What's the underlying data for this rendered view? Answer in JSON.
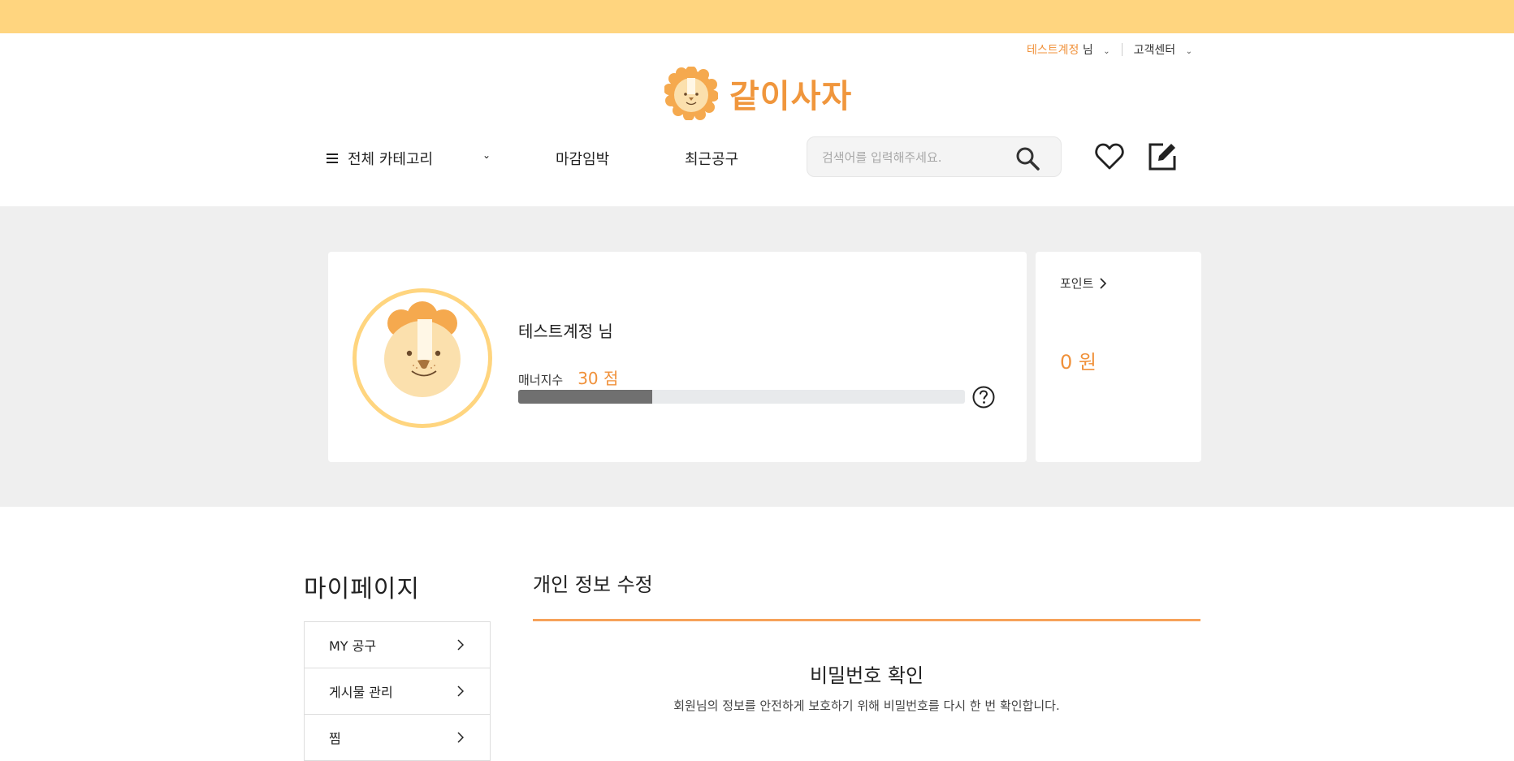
{
  "header": {
    "user_name": "테스트계정",
    "user_suffix": "님",
    "customer_center": "고객센터",
    "logo_text": "같이사자"
  },
  "nav": {
    "all_categories": "전체 카테고리",
    "deadline": "마감임박",
    "recent_group_buy": "최근공구",
    "search_placeholder": "검색어를 입력해주세요."
  },
  "profile": {
    "name": "테스트계정 님",
    "manner_label": "매너지수",
    "manner_value": "30 점",
    "manner_progress": 0.3
  },
  "point": {
    "label": "포인트",
    "value": "0 원"
  },
  "mypage": {
    "title": "마이페이지",
    "menu": [
      {
        "label": "MY 공구"
      },
      {
        "label": "게시물 관리"
      },
      {
        "label": "찜"
      }
    ]
  },
  "content": {
    "title": "개인 정보 수정",
    "password_title": "비밀번호 확인",
    "password_desc": "회원님의 정보를 안전하게 보호하기 위해 비밀번호를 다시 한 번 확인합니다."
  },
  "colors": {
    "accent": "#f0913a",
    "topbar": "#ffd57f",
    "band": "#efefef"
  }
}
